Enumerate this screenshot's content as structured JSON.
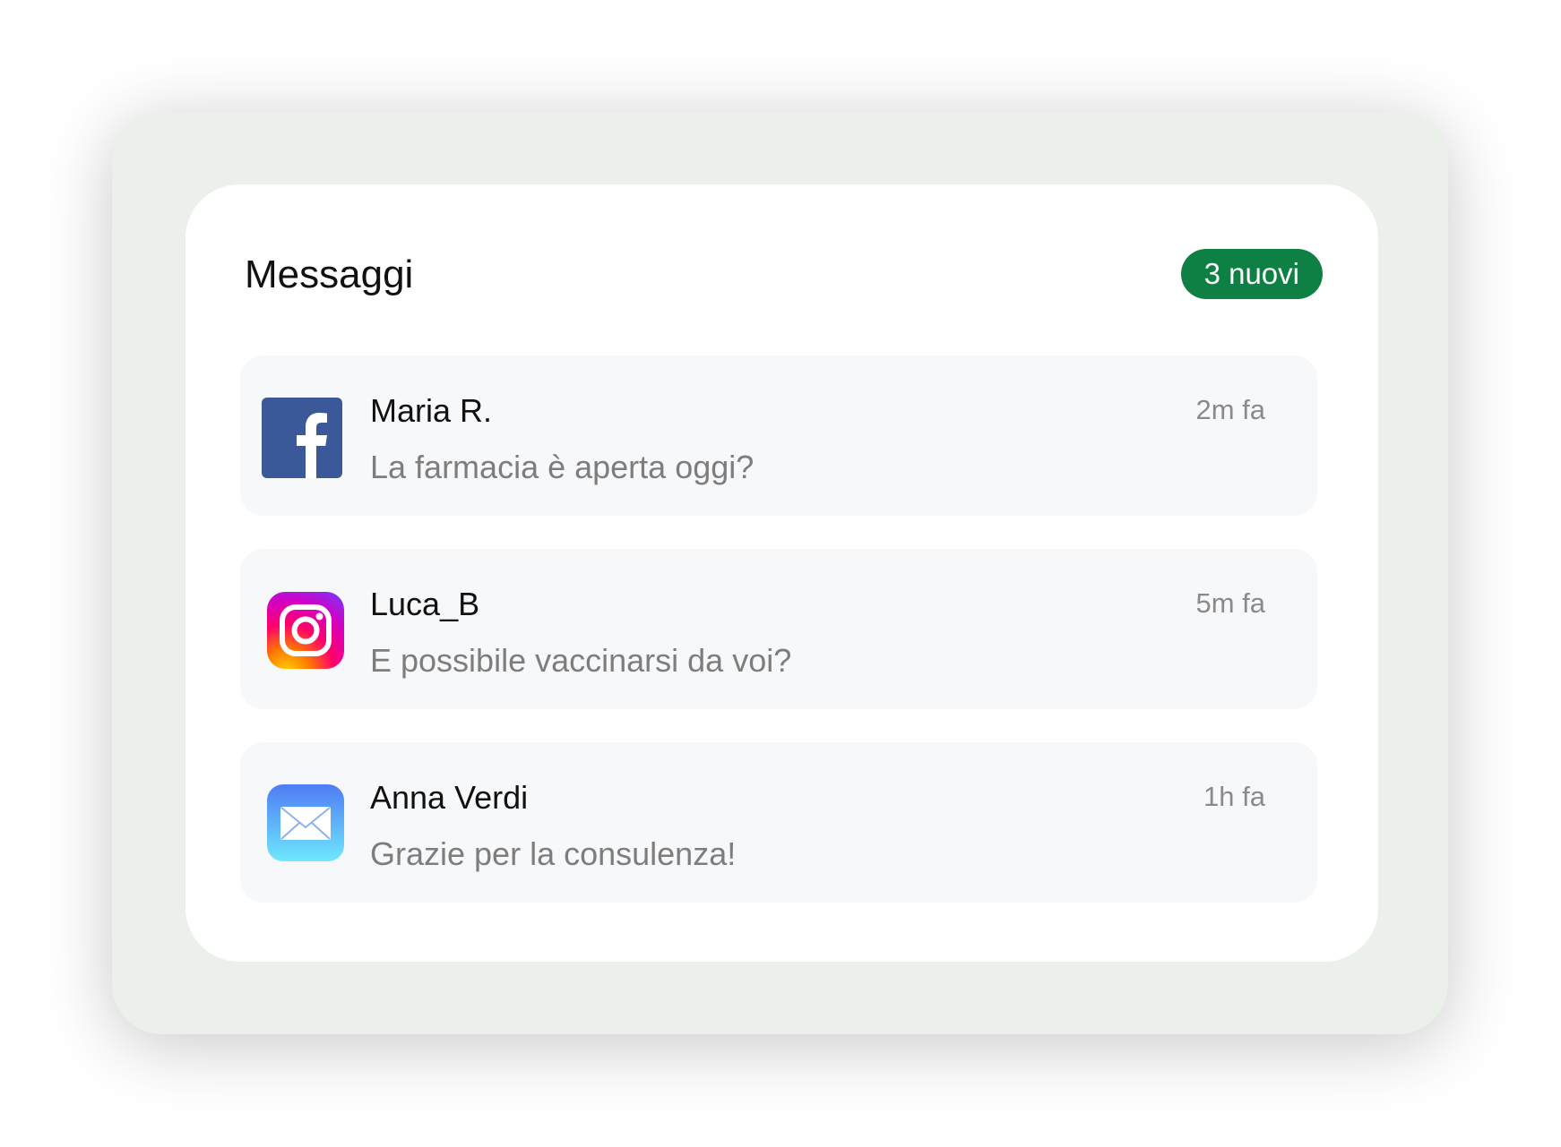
{
  "panel": {
    "title": "Messaggi",
    "badge": "3 nuovi",
    "badge_color": "#0e8043",
    "background_color": "#ecf0ea"
  },
  "messages": [
    {
      "source_icon": "facebook-icon",
      "sender": "Maria R.",
      "text": "La farmacia è aperta oggi?",
      "time": "2m fa"
    },
    {
      "source_icon": "instagram-icon",
      "sender": "Luca_B",
      "text": "E possibile vaccinarsi da voi?",
      "time": "5m fa"
    },
    {
      "source_icon": "mail-icon",
      "sender": "Anna Verdi",
      "text": "Grazie per la consulenza!",
      "time": "1h fa"
    }
  ]
}
